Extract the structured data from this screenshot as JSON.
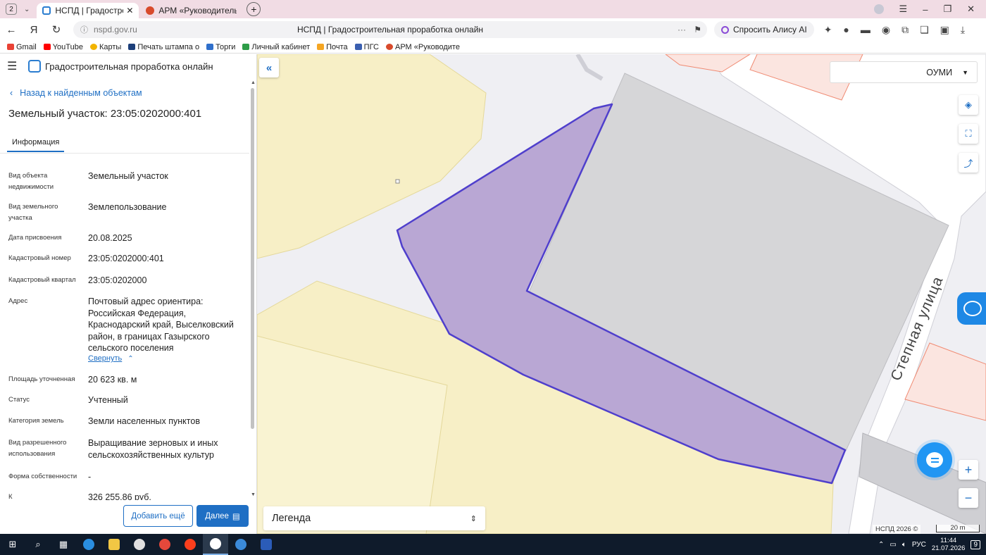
{
  "browser": {
    "tab_count": "2",
    "tabs": [
      {
        "title": "НСПД | Градостроительна",
        "active": true
      },
      {
        "title": "АРМ «Руководитель»",
        "active": false
      }
    ],
    "url": "nspd.gov.ru",
    "page_title": "НСПД | Градостроительная проработка онлайн",
    "alice_label": "Спросить Алису AI",
    "bookmarks": [
      "Gmail",
      "YouTube",
      "Карты",
      "Печать штампа о",
      "Торги",
      "Личный кабинет",
      "Почта",
      "ПГС",
      "АРМ «Руководите"
    ]
  },
  "app": {
    "title": "Градостроительная проработка онлайн",
    "back_label": "Назад к найденным объектам",
    "object_title": "Земельный участок: 23:05:0202000:401",
    "tab_info": "Информация",
    "properties": [
      {
        "label": "Вид объекта недвижимости",
        "value": "Земельный участок"
      },
      {
        "label": "Вид земельного участка",
        "value": "Землепользование"
      },
      {
        "label": "Дата присвоения",
        "value": "20.08.2025"
      },
      {
        "label": "Кадастровый номер",
        "value": "23:05:0202000:401"
      },
      {
        "label": "Кадастровый квартал",
        "value": "23:05:0202000"
      },
      {
        "label": "Адрес",
        "value": "Почтовый адрес ориентира: Российская Федерация, Краснодарский край, Выселковский район, в границах Газырского сельского поселения"
      },
      {
        "label": "Площадь уточненная",
        "value": "20 623 кв. м"
      },
      {
        "label": "Статус",
        "value": "Учтенный"
      },
      {
        "label": "Категория земель",
        "value": "Земли населенных пунктов"
      },
      {
        "label": "Вид разрешенного использования",
        "value": "Выращивание зерновых и иных сельскохозяйственных культур"
      },
      {
        "label": "Форма собственности",
        "value": "-"
      },
      {
        "label": "К",
        "value": "326 255,86 руб."
      }
    ],
    "collapse_label": "Свернуть",
    "add_more_label": "Добавить ещё",
    "next_label": "Далее"
  },
  "map": {
    "layer_select": "ОУМИ",
    "street_label": "Степная улица",
    "legend_label": "Легенда",
    "copyright": "НСПД 2026 ©",
    "scale_label": "20 m",
    "parcel_fill": "#b9a7d4",
    "parcel_stroke": "#4f3fcc"
  },
  "taskbar": {
    "lang": "РУС",
    "time": "11:44",
    "date": "21.07.2026",
    "notifications": "9"
  }
}
